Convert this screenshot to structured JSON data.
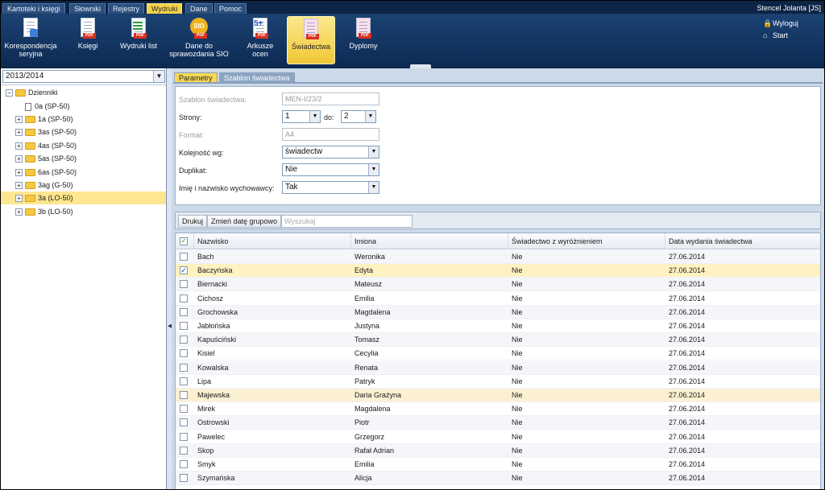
{
  "menu": {
    "tabs": [
      {
        "label": "Kartoteki i księgi"
      },
      {
        "label": "Słowniki"
      },
      {
        "label": "Rejestry"
      },
      {
        "label": "Wydruki"
      },
      {
        "label": "Dane"
      },
      {
        "label": "Pomoc"
      }
    ],
    "active_tab": "Wydruki",
    "user": "Stencel Jolanta [JS]"
  },
  "ribbon": {
    "buttons": [
      {
        "line1": "Korespondencja",
        "line2": "seryjna"
      },
      {
        "line1": "Księgi",
        "line2": ""
      },
      {
        "line1": "Wydruki list",
        "line2": ""
      },
      {
        "line1": "Dane do",
        "line2": "sprawozdania SIO",
        "badge": "SIO"
      },
      {
        "line1": "Arkusze",
        "line2": "ocen",
        "badge": "5+"
      },
      {
        "line1": "Świadectwa",
        "line2": ""
      },
      {
        "line1": "Dyplomy",
        "line2": ""
      }
    ],
    "active_button": "Świadectwa",
    "logout": "Wyloguj",
    "start": "Start"
  },
  "left": {
    "year": "2013/2014",
    "tree": {
      "root": "Dzienniki",
      "items": [
        {
          "label": "0a (SP-50)"
        },
        {
          "label": "1a (SP-50)"
        },
        {
          "label": "3as (SP-50)"
        },
        {
          "label": "4as (SP-50)"
        },
        {
          "label": "5as (SP-50)"
        },
        {
          "label": "6as (SP-50)"
        },
        {
          "label": "3ag (G-50)"
        },
        {
          "label": "3a (LO-50)"
        },
        {
          "label": "3b (LO-50)"
        }
      ],
      "selected": "3a (LO-50)"
    }
  },
  "tabs": [
    {
      "label": "Parametry"
    },
    {
      "label": "Szablon świadectwa"
    }
  ],
  "form": {
    "szablon_label": "Szablon świadectwa:",
    "szablon_value": "MEN-I/23/2",
    "strony_label": "Strony:",
    "strony_from": "1",
    "strony_do_label": "do:",
    "strony_to": "2",
    "format_label": "Format:",
    "format_value": "A4",
    "kolejnosc_label": "Kolejność wg:",
    "kolejnosc_value": "świadectw",
    "duplikat_label": "Duplikat:",
    "duplikat_value": "Nie",
    "wychowawca_label": "Imię i nazwisko wychowawcy:",
    "wychowawca_value": "Tak"
  },
  "toolbar": {
    "print_label": "Drukuj",
    "change_date_label": "Zmień datę grupowo",
    "search_placeholder": "Wyszukaj"
  },
  "table": {
    "columns": [
      "Nazwisko",
      "Imiona",
      "Świadectwo z wyróżnieniem",
      "Data wydania świadectwa"
    ],
    "rows": [
      {
        "nazwisko": "Bach",
        "imiona": "Weronika",
        "wyr": "Nie",
        "data": "27.06.2014",
        "checked": false
      },
      {
        "nazwisko": "Baczyńska",
        "imiona": "Edyta",
        "wyr": "Nie",
        "data": "27.06.2014",
        "checked": true
      },
      {
        "nazwisko": "Biernacki",
        "imiona": "Mateusz",
        "wyr": "Nie",
        "data": "27.06.2014",
        "checked": false
      },
      {
        "nazwisko": "Cichosz",
        "imiona": "Emilia",
        "wyr": "Nie",
        "data": "27.06.2014",
        "checked": false
      },
      {
        "nazwisko": "Grochowska",
        "imiona": "Magdalena",
        "wyr": "Nie",
        "data": "27.06.2014",
        "checked": false
      },
      {
        "nazwisko": "Jabłońska",
        "imiona": "Justyna",
        "wyr": "Nie",
        "data": "27.06.2014",
        "checked": false
      },
      {
        "nazwisko": "Kapuściński",
        "imiona": "Tomasz",
        "wyr": "Nie",
        "data": "27.06.2014",
        "checked": false
      },
      {
        "nazwisko": "Kisiel",
        "imiona": "Cecylia",
        "wyr": "Nie",
        "data": "27.06.2014",
        "checked": false
      },
      {
        "nazwisko": "Kowalska",
        "imiona": "Renata",
        "wyr": "Nie",
        "data": "27.06.2014",
        "checked": false
      },
      {
        "nazwisko": "Lipa",
        "imiona": "Patryk",
        "wyr": "Nie",
        "data": "27.06.2014",
        "checked": false
      },
      {
        "nazwisko": "Majewska",
        "imiona": "Daria Grażyna",
        "wyr": "Nie",
        "data": "27.06.2014",
        "checked": false
      },
      {
        "nazwisko": "Mirek",
        "imiona": "Magdalena",
        "wyr": "Nie",
        "data": "27.06.2014",
        "checked": false
      },
      {
        "nazwisko": "Ostrowski",
        "imiona": "Piotr",
        "wyr": "Nie",
        "data": "27.06.2014",
        "checked": false
      },
      {
        "nazwisko": "Pawelec",
        "imiona": "Grzegorz",
        "wyr": "Nie",
        "data": "27.06.2014",
        "checked": false
      },
      {
        "nazwisko": "Skop",
        "imiona": "Rafał Adrian",
        "wyr": "Nie",
        "data": "27.06.2014",
        "checked": false
      },
      {
        "nazwisko": "Smyk",
        "imiona": "Emilia",
        "wyr": "Nie",
        "data": "27.06.2014",
        "checked": false
      },
      {
        "nazwisko": "Szymańska",
        "imiona": "Alicja",
        "wyr": "Nie",
        "data": "27.06.2014",
        "checked": false
      }
    ]
  },
  "colors": {
    "accent": "#f3d24a",
    "header_bg": "#0c2546",
    "selected_row": "#fff2c2"
  }
}
